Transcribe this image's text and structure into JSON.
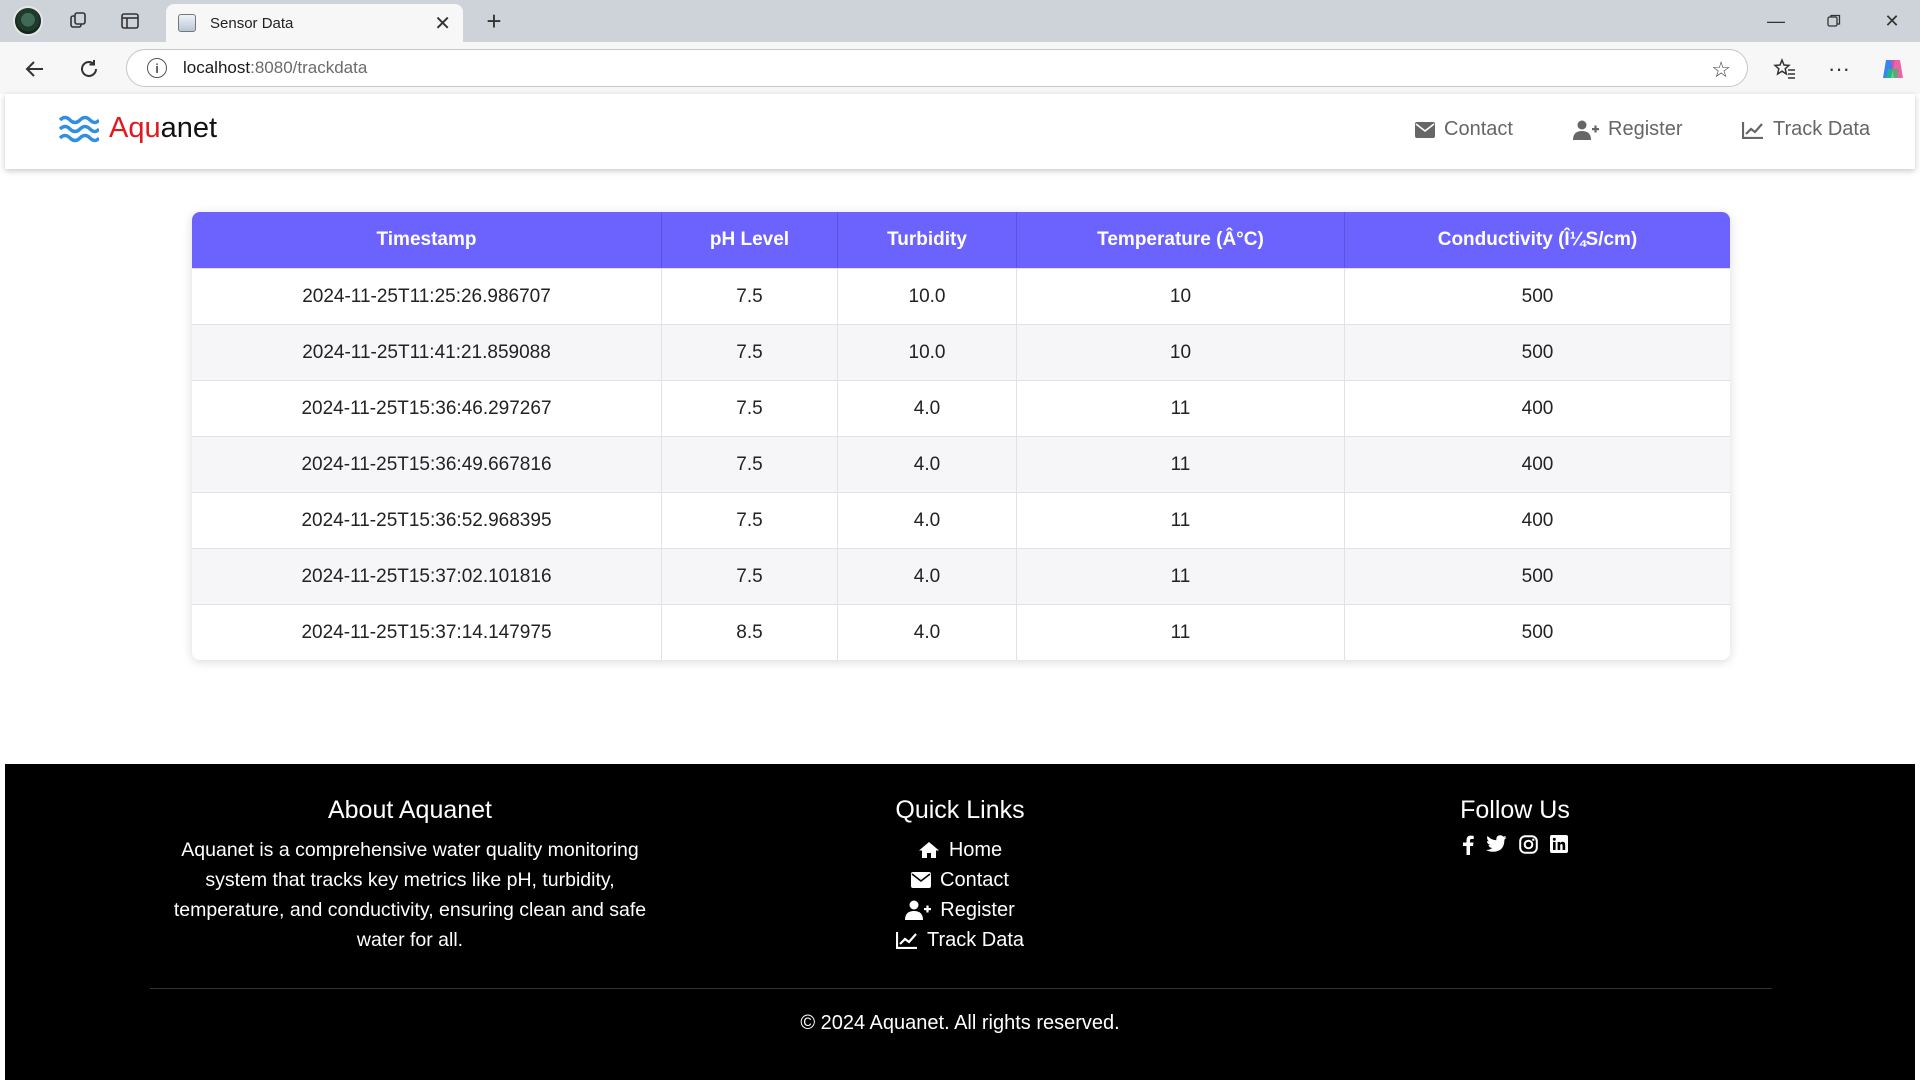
{
  "browser": {
    "tab_title": "Sensor Data",
    "url_host": "localhost",
    "url_rest": ":8080/trackdata"
  },
  "navbar": {
    "brand_part1": "Aqu",
    "brand_part2": "anet",
    "links": [
      {
        "label": "Contact",
        "icon": "envelope-icon"
      },
      {
        "label": "Register",
        "icon": "user-plus-icon"
      },
      {
        "label": "Track Data",
        "icon": "chart-line-icon"
      }
    ]
  },
  "table": {
    "headers": [
      "Timestamp",
      "pH Level",
      "Turbidity",
      "Temperature (Â°C)",
      "Conductivity (Î¼S/cm)"
    ],
    "rows": [
      [
        "2024-11-25T11:25:26.986707",
        "7.5",
        "10.0",
        "10",
        "500"
      ],
      [
        "2024-11-25T11:41:21.859088",
        "7.5",
        "10.0",
        "10",
        "500"
      ],
      [
        "2024-11-25T15:36:46.297267",
        "7.5",
        "4.0",
        "11",
        "400"
      ],
      [
        "2024-11-25T15:36:49.667816",
        "7.5",
        "4.0",
        "11",
        "400"
      ],
      [
        "2024-11-25T15:36:52.968395",
        "7.5",
        "4.0",
        "11",
        "400"
      ],
      [
        "2024-11-25T15:37:02.101816",
        "7.5",
        "4.0",
        "11",
        "500"
      ],
      [
        "2024-11-25T15:37:14.147975",
        "8.5",
        "4.0",
        "11",
        "500"
      ]
    ]
  },
  "footer": {
    "about_title": "About Aquanet",
    "about_text": "Aquanet is a comprehensive water quality monitoring system that tracks key metrics like pH, turbidity, temperature, and conductivity, ensuring clean and safe water for all.",
    "links_title": "Quick Links",
    "links": [
      {
        "label": "Home",
        "icon": "home-icon"
      },
      {
        "label": "Contact",
        "icon": "envelope-icon"
      },
      {
        "label": "Register",
        "icon": "user-plus-icon"
      },
      {
        "label": "Track Data",
        "icon": "chart-line-icon"
      }
    ],
    "follow_title": "Follow Us",
    "social": [
      "facebook-icon",
      "twitter-icon",
      "instagram-icon",
      "linkedin-icon"
    ],
    "copyright": "© 2024 Aquanet. All rights reserved."
  },
  "colors": {
    "table_header": "#6c63ff",
    "brand_red": "#e0191f",
    "logo_blue": "#2f8fe0",
    "footer_bg": "#000000"
  }
}
